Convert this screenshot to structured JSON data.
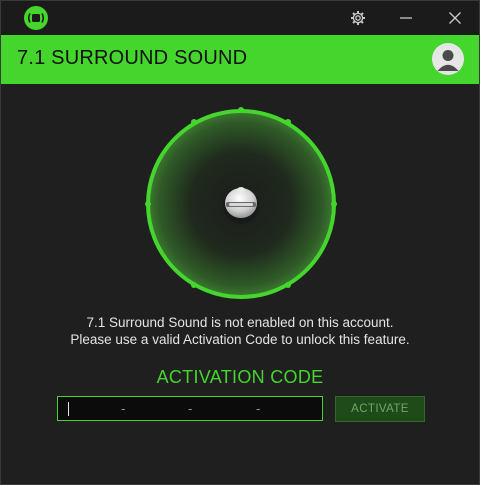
{
  "titlebar": {
    "logo_icon": "razer-surround-logo-icon",
    "settings_icon": "gear-icon",
    "minimize_icon": "minimize-icon",
    "close_icon": "close-icon"
  },
  "header": {
    "title": "7.1 SURROUND SOUND",
    "avatar_icon": "user-avatar-icon"
  },
  "visualizer": {
    "speaker_icon": "listener-head-icon",
    "speaker_nodes": 8
  },
  "message": {
    "line1": "7.1 Surround Sound is not enabled on this account.",
    "line2": "Please use a valid Activation Code to unlock this feature."
  },
  "activation": {
    "heading": "ACTIVATION CODE",
    "separator": "-",
    "button_label": "ACTIVATE"
  },
  "colors": {
    "accent": "#44d62c",
    "background": "#1f1f1f",
    "titlebar": "#1b1b1b",
    "button_bg": "#1f4a1a",
    "button_text": "#6fa765"
  }
}
